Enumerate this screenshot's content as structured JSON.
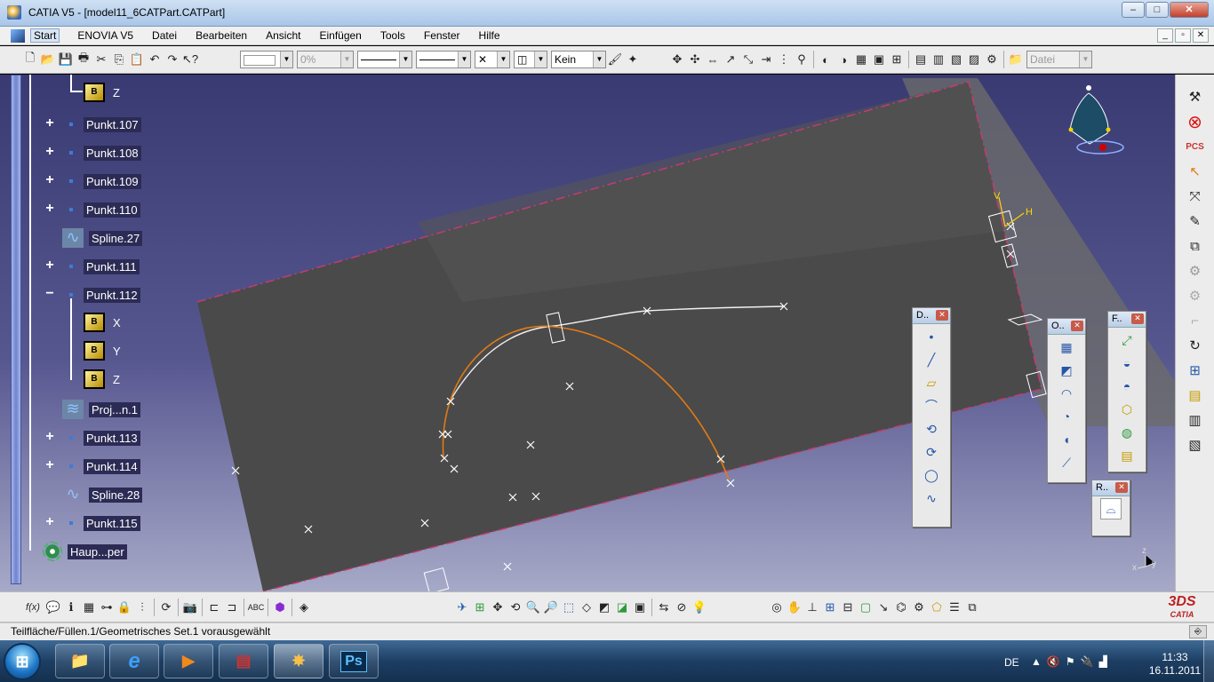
{
  "window": {
    "title": "CATIA V5 - [model11_6CATPart.CATPart]",
    "minimize": "–",
    "maximize": "□",
    "close": "✕"
  },
  "menu": {
    "items": [
      "Start",
      "ENOVIA V5",
      "Datei",
      "Bearbeiten",
      "Ansicht",
      "Einfügen",
      "Tools",
      "Fenster",
      "Hilfe"
    ],
    "doc_buttons": [
      "_",
      "▫",
      "✕"
    ]
  },
  "toolbar_top": {
    "transparency": "0%",
    "layer": "Kein",
    "filter": "Datei",
    "line_x": "✕"
  },
  "tree": {
    "nodes": [
      {
        "label": "Z",
        "type": "axis"
      },
      {
        "label": "Punkt.107",
        "type": "point"
      },
      {
        "label": "Punkt.108",
        "type": "point"
      },
      {
        "label": "Punkt.109",
        "type": "point"
      },
      {
        "label": "Punkt.110",
        "type": "point"
      },
      {
        "label": "Spline.27",
        "type": "spline"
      },
      {
        "label": "Punkt.111",
        "type": "point"
      },
      {
        "label": "Punkt.112",
        "type": "point"
      },
      {
        "label": "X",
        "type": "axis"
      },
      {
        "label": "Y",
        "type": "axis"
      },
      {
        "label": "Z",
        "type": "axis"
      },
      {
        "label": "Proj...n.1",
        "type": "projection"
      },
      {
        "label": "Punkt.113",
        "type": "point"
      },
      {
        "label": "Punkt.114",
        "type": "point"
      },
      {
        "label": "Spline.28",
        "type": "spline"
      },
      {
        "label": "Punkt.115",
        "type": "point"
      },
      {
        "label": "Haup...per",
        "type": "body"
      }
    ]
  },
  "palettes": [
    {
      "title": "D..",
      "icons": [
        "point-icon",
        "line-icon",
        "plane-icon",
        "project-icon",
        "combine-icon",
        "reflect-line-icon",
        "circle-icon",
        "spline-icon"
      ]
    },
    {
      "title": "O..",
      "icons": [
        "extrude-icon",
        "revolve-icon",
        "sphere-icon",
        "cylinder-icon",
        "offset-icon",
        "sweep-icon"
      ]
    },
    {
      "title": "F..",
      "icons": [
        "fill-icon",
        "loft-icon",
        "blend-icon",
        "multi-section-icon",
        "join-icon",
        "healing-icon"
      ]
    },
    {
      "title": "R..",
      "icons": [
        "analysis-icon"
      ]
    }
  ],
  "viewport": {
    "compass_labels": {
      "h": "H",
      "v": "V"
    },
    "axis_labels": {
      "x": "x",
      "y": "y",
      "z": "z"
    }
  },
  "toolbar_bottom": {
    "formula_label": "f(x)"
  },
  "logo": {
    "ds": "3DS",
    "catia": "CATIA"
  },
  "status": {
    "text": "Teilfläche/Füllen.1/Geometrisches Set.1 vorausgewählt"
  },
  "taskbar": {
    "start": "⊞",
    "apps": [
      "explorer",
      "internet-explorer",
      "media-player",
      "winrar",
      "catia",
      "photoshop"
    ],
    "ps_label": "Ps",
    "ie_label": "e",
    "language": "DE",
    "time": "11:33",
    "date": "16.11.2011"
  }
}
